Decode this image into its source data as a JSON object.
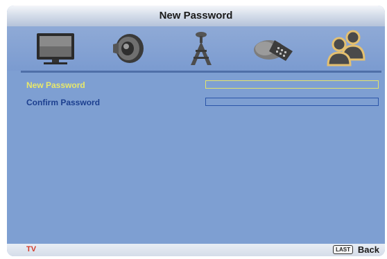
{
  "window": {
    "title": "New Password"
  },
  "menu": {
    "tabs": [
      {
        "icon": "tv-picture-icon",
        "selected": false
      },
      {
        "icon": "speaker-sound-icon",
        "selected": false
      },
      {
        "icon": "antenna-setup-icon",
        "selected": false
      },
      {
        "icon": "remote-control-options-icon",
        "selected": false
      },
      {
        "icon": "users-lock-icon",
        "selected": true
      }
    ]
  },
  "form": {
    "new_password": {
      "label": "New Password",
      "value": "",
      "active": true
    },
    "confirm_password": {
      "label": "Confirm Password",
      "value": "",
      "active": false
    }
  },
  "footer": {
    "source": "TV",
    "last_key": "LAST",
    "back_label": "Back"
  },
  "colors": {
    "background": "#7e9fd2",
    "active_text": "#e8e86a",
    "normal_text": "#1c3f8f",
    "source_text": "#d23b2a"
  }
}
